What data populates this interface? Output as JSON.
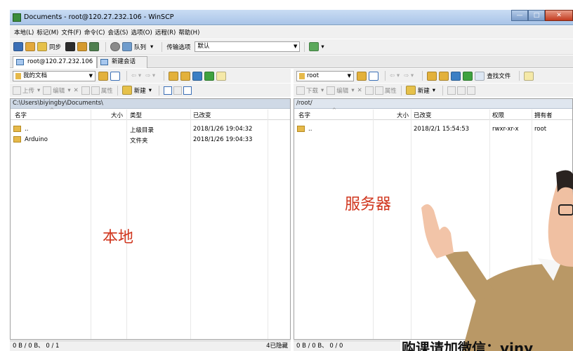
{
  "window": {
    "title": "Documents - root@120.27.232.106 - WinSCP"
  },
  "menu": [
    "本地(L)",
    "标记(M)",
    "文件(F)",
    "命令(C)",
    "会话(S)",
    "选项(O)",
    "远程(R)",
    "帮助(H)"
  ],
  "toolbar": {
    "sync_label": "同步",
    "queue_label": "队列",
    "transfer_label": "传输选项",
    "transfer_value": "默认"
  },
  "tabs": {
    "session": "root@120.27.232.106",
    "new_session": "新建会话"
  },
  "left": {
    "location": "我的文档",
    "actions": {
      "upload": "上传",
      "edit": "编辑",
      "properties": "属性",
      "new": "新建"
    },
    "path": "C:\\Users\\biyingby\\Documents\\",
    "columns": {
      "name": "名字",
      "size": "大小",
      "type": "类型",
      "changed": "已改变"
    },
    "rows": [
      {
        "name": "..",
        "type": "上级目录",
        "changed": "2018/1/26  19:04:32"
      },
      {
        "name": "Arduino",
        "type": "文件夹",
        "changed": "2018/1/26  19:04:33"
      }
    ],
    "status": "0 B / 0 B、 0 / 1",
    "hidden": "4已隐藏"
  },
  "right": {
    "location": "root",
    "find_label": "查找文件",
    "actions": {
      "download": "下载",
      "edit": "编辑",
      "properties": "属性",
      "new": "新建"
    },
    "path": "/root/",
    "columns": {
      "name": "名字",
      "size": "大小",
      "changed": "已改变",
      "rights": "权限",
      "owner": "拥有者"
    },
    "rows": [
      {
        "name": "..",
        "changed": "2018/2/1  15:54:53",
        "rights": "rwxr-xr-x",
        "owner": "root"
      }
    ],
    "status": "0 B / 0 B、 0 / 0"
  },
  "overlays": {
    "local": "本地",
    "server": "服务器",
    "banner": "购课请加微信：viny"
  },
  "colors": {
    "accent_text": "#d0361e",
    "folder": "#e6b94a"
  }
}
